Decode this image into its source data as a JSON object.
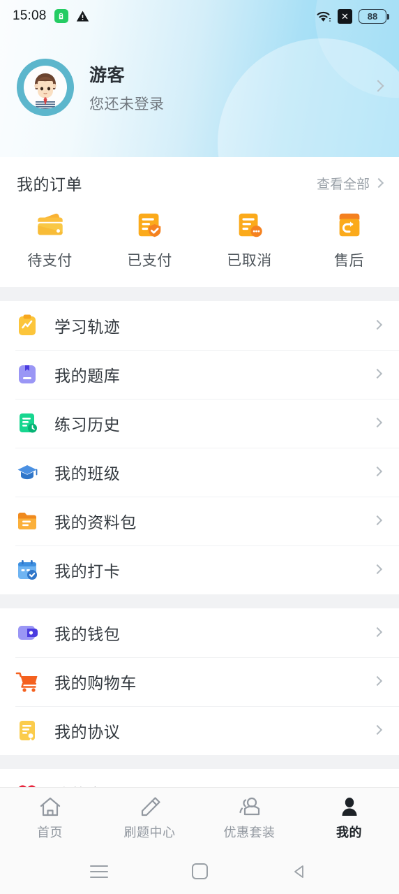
{
  "status_bar": {
    "time": "15:08",
    "icons": [
      "bag-icon",
      "warning-icon",
      "wifi-icon",
      "no-sim-icon"
    ],
    "battery_level": "88"
  },
  "profile": {
    "name": "游客",
    "subtitle": "您还未登录",
    "avatar_alt": "avatar",
    "arrow": "chevron-right-icon"
  },
  "orders": {
    "title": "我的订单",
    "view_all": "查看全部",
    "items": [
      {
        "label": "待支付",
        "icon": "wallet-card-icon"
      },
      {
        "label": "已支付",
        "icon": "document-check-icon"
      },
      {
        "label": "已取消",
        "icon": "document-dots-icon"
      },
      {
        "label": "售后",
        "icon": "box-return-icon"
      }
    ]
  },
  "menu_groups": [
    {
      "items": [
        {
          "label": "学习轨迹",
          "icon": "clipboard-wave-icon"
        },
        {
          "label": "我的题库",
          "icon": "question-bank-icon"
        },
        {
          "label": "练习历史",
          "icon": "history-doc-icon"
        },
        {
          "label": "我的班级",
          "icon": "graduation-cap-icon"
        },
        {
          "label": "我的资料包",
          "icon": "folder-icon"
        },
        {
          "label": "我的打卡",
          "icon": "calendar-check-icon"
        }
      ]
    },
    {
      "items": [
        {
          "label": "我的钱包",
          "icon": "wallet-icon"
        },
        {
          "label": "我的购物车",
          "icon": "shopping-cart-icon"
        },
        {
          "label": "我的协议",
          "icon": "agreement-doc-icon"
        }
      ]
    },
    {
      "items": [
        {
          "label": "我的客服",
          "icon": "heart-icon"
        }
      ]
    }
  ],
  "tab_bar": {
    "items": [
      {
        "label": "首页",
        "icon": "home-icon",
        "active": false
      },
      {
        "label": "刷题中心",
        "icon": "pencil-icon",
        "active": false
      },
      {
        "label": "优惠套装",
        "icon": "people-icon",
        "active": false
      },
      {
        "label": "我的",
        "icon": "person-icon",
        "active": true
      }
    ]
  },
  "system_nav": {
    "recents": "recents-icon",
    "home": "home-square-icon",
    "back": "back-triangle-icon"
  },
  "colors": {
    "header_gradient_start": "#fbfdfe",
    "header_gradient_end": "#8ed8f5",
    "accent_orange": "#f7a325",
    "avatar_ring": "#5cb6cc",
    "page_bg": "#f1f2f4"
  }
}
